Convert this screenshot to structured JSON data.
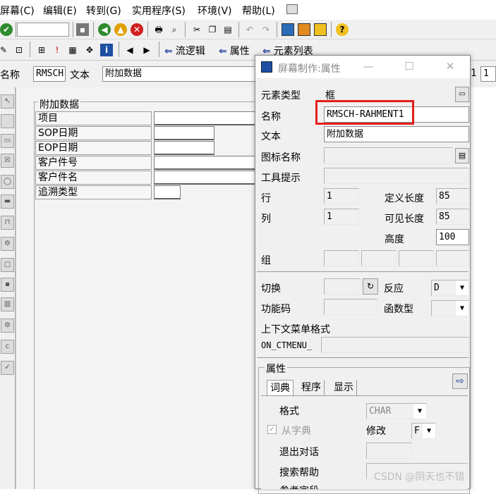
{
  "menubar": {
    "items": [
      "屏幕(C)",
      "编辑(E)",
      "转到(G)",
      "实用程序(S)",
      "环境(V)",
      "帮助(L)"
    ]
  },
  "toolbar2": {
    "nav_flow_logic": "流逻辑",
    "nav_attributes": "属性",
    "nav_element_list": "元素列表"
  },
  "field_row": {
    "name_label": "名称",
    "name_value": "RMSCH",
    "text_label": "文本",
    "text_value": "附加数据",
    "right_value_1": "1",
    "right_value_2": "1"
  },
  "canvas": {
    "frame_title": "附加数据",
    "rows": [
      {
        "label": "项目"
      },
      {
        "label": "SOP日期"
      },
      {
        "label": "EOP日期"
      },
      {
        "label": "客户件号"
      },
      {
        "label": "客户件名"
      },
      {
        "label": "追溯类型"
      }
    ]
  },
  "dialog": {
    "title": "屏幕制作:属性",
    "element_type_label": "元素类型",
    "element_type_value": "框",
    "name_label": "名称",
    "name_value": "RMSCH-RAHMENT1",
    "text_label": "文本",
    "text_value": "附加数据",
    "icon_name_label": "图标名称",
    "tooltip_label": "工具提示",
    "row_label": "行",
    "row_value": "1",
    "col_label": "列",
    "col_value": "1",
    "def_length_label": "定义长度",
    "def_length_value": "85",
    "vis_length_label": "可见长度",
    "vis_length_value": "85",
    "height_label": "高度",
    "height_value": "100",
    "group_label": "组",
    "switch_label": "切换",
    "react_label": "反应",
    "react_value": "D",
    "fcode_label": "功能码",
    "ftype_label": "函数型",
    "ctx_menu_label": "上下文菜单格式",
    "ctx_menu_prefix": "ON_CTMENU_",
    "attr_group_label": "属性",
    "tabs": [
      "词典",
      "程序",
      "显示"
    ],
    "format_label": "格式",
    "format_value": "CHAR",
    "from_dict_label": "从字典",
    "modify_label": "修改",
    "modify_value": "F",
    "exit_dialog_label": "退出对话",
    "search_help_label": "搜索帮助",
    "ref_field_label": "参考字段"
  },
  "watermark": "CSDN @阴天也不错",
  "colors": {
    "highlight": "#e61e1e",
    "nav_arrow": "#1e3c9b"
  }
}
